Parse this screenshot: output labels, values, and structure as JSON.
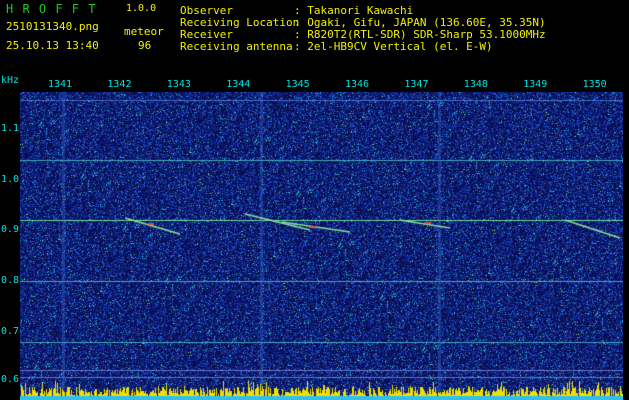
{
  "header": {
    "app_name": "H R O F F T",
    "version": "1.0.0",
    "filename": "2510131340.png",
    "timestamp": "25.10.13 13:40",
    "mode_label": "meteor",
    "count": "96"
  },
  "info": {
    "observer_label": "Observer",
    "observer_value": ": Takanori Kawachi",
    "location_label": "Receiving Location",
    "location_value": ": Ogaki, Gifu, JAPAN (136.60E, 35.35N)",
    "receiver_label": "Receiver",
    "receiver_value": ": R820T2(RTL-SDR) SDR-Sharp 53.1000MHz",
    "antenna_label": "Receiving antenna",
    "antenna_value": ": 2el-HB9CV Vertical (el. E-W)"
  },
  "axis": {
    "y_unit": "kHz",
    "y_ticks": [
      "1.1",
      "1.0",
      "0.9",
      "0.8",
      "0.7",
      "0.6"
    ],
    "x_ticks": [
      "1341",
      "1342",
      "1343",
      "1344",
      "1345",
      "1346",
      "1347",
      "1348",
      "1349",
      "1350"
    ]
  },
  "colors": {
    "background": "#000000",
    "spectrogram_base": "#0a1060",
    "header_green": "#1ec81e",
    "header_yellow": "#f0f000",
    "axis_cyan": "#00e0e0",
    "signal_green": "#40e890"
  }
}
